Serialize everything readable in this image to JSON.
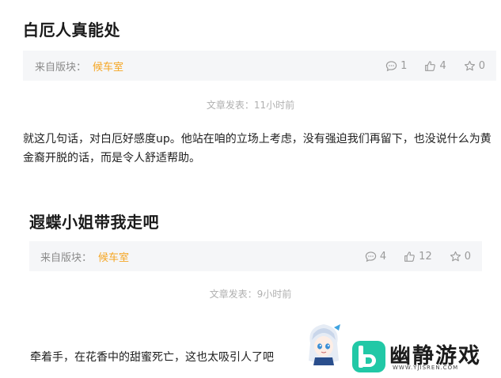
{
  "posts": [
    {
      "title": "白厄人真能处",
      "board_label": "来自版块：",
      "board_name": "候车室",
      "comments": "1",
      "likes": "4",
      "favorites": "0",
      "publish_time": "文章发表：11小时前",
      "body": "就这几句话，对白厄好感度up。他站在咱的立场上考虑，没有强迫我们再留下，也没说什么为黄金裔开脱的话，而是令人舒适帮助。"
    },
    {
      "title": "遐蝶小姐带我走吧",
      "board_label": "来自版块：",
      "board_name": "候车室",
      "comments": "4",
      "likes": "12",
      "favorites": "0",
      "publish_time": "文章发表：9小时前",
      "body": "牵着手，在花香中的甜蜜死亡，这也太吸引人了吧"
    }
  ],
  "watermark": {
    "brand": "幽静游戏",
    "url": "WWW.YJISREN.COM"
  },
  "colors": {
    "board_accent": "#f5a623",
    "logo_accent": "#21c8a6",
    "meta_bg": "#f5f6f8"
  },
  "icons": [
    "comment-icon",
    "thumbs-up-icon",
    "star-icon"
  ]
}
